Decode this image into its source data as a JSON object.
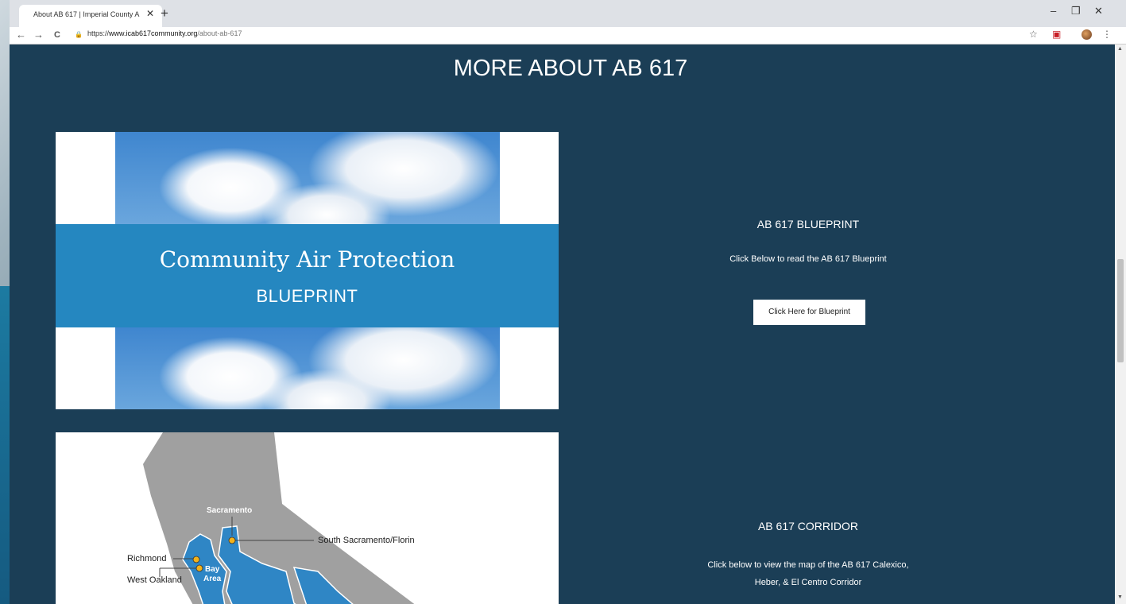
{
  "browser": {
    "tab_title": "About AB 617 | Imperial County A",
    "tab_close": "✕",
    "new_tab": "+",
    "url_scheme": "https://",
    "url_host": "www.icab617community.org",
    "url_path": "/about-ab-617",
    "window_controls": {
      "minimize": "–",
      "restore": "❐",
      "close": "✕"
    },
    "nav": {
      "back": "←",
      "forward": "→",
      "reload": "C",
      "lock": "🔒"
    },
    "toolbar_icons": {
      "star": "☆",
      "pdf": "▣",
      "menu": "⋮"
    }
  },
  "page": {
    "title": "MORE ABOUT AB 617",
    "blueprint_card": {
      "title": "Community Air Protection",
      "subtitle": "BLUEPRINT"
    },
    "blueprint_section": {
      "heading": "AB 617 BLUEPRINT",
      "text": "Click Below to read the AB 617 Blueprint",
      "button_label": "Click Here for Blueprint"
    },
    "map_card": {
      "labels": {
        "sacramento": "Sacramento",
        "south_sacramento": "South Sacramento/Florin",
        "richmond": "Richmond",
        "west_oakland": "West Oakland",
        "bay": "Bay",
        "area": "Area"
      }
    },
    "corridor_section": {
      "heading": "AB 617 CORRIDOR",
      "text_line1": "Click below to view the map of the AB 617 Calexico,",
      "text_line2": "Heber, & El Centro Corridor"
    }
  },
  "colors": {
    "page_bg": "#1b3e56",
    "band": "#2587c0",
    "map_gray": "#a0a0a0",
    "map_blue": "#2f86c5",
    "marker": "#f3b21a"
  },
  "icons": [
    "lock-icon",
    "star-icon",
    "pdf-icon",
    "avatar-icon",
    "menu-icon",
    "back-icon",
    "forward-icon",
    "reload-icon"
  ]
}
